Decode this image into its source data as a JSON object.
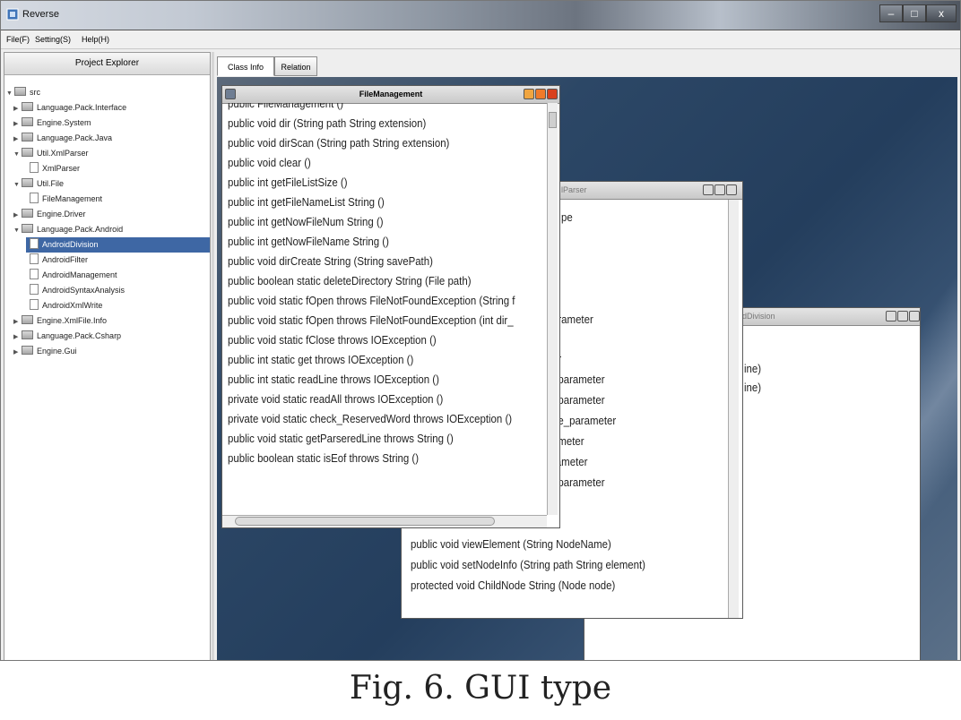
{
  "window": {
    "title": "Reverse",
    "min": "–",
    "max": "□",
    "close": "x"
  },
  "menu": [
    "File(F)",
    "Setting(S)",
    "Help(H)"
  ],
  "explorer": {
    "header": "Project Explorer",
    "root": "src",
    "nodes": [
      {
        "label": "Language.Pack.Interface",
        "type": "folder"
      },
      {
        "label": "Engine.System",
        "type": "folder"
      },
      {
        "label": "Language.Pack.Java",
        "type": "folder"
      },
      {
        "label": "Util.XmlParser",
        "type": "folder"
      },
      {
        "label": "XmlParser",
        "type": "file"
      },
      {
        "label": "Util.File",
        "type": "folder"
      },
      {
        "label": "FileManagement",
        "type": "file"
      },
      {
        "label": "Engine.Driver",
        "type": "folder"
      },
      {
        "label": "Language.Pack.Android",
        "type": "folder"
      },
      {
        "label": "AndroidDivision",
        "type": "file",
        "selected": true
      },
      {
        "label": "AndroidFilter",
        "type": "file"
      },
      {
        "label": "AndroidManagement",
        "type": "file"
      },
      {
        "label": "AndroidSyntaxAnalysis",
        "type": "file"
      },
      {
        "label": "AndroidXmlWrite",
        "type": "file"
      },
      {
        "label": "Engine.XmlFile.Info",
        "type": "folder"
      },
      {
        "label": "Language.Pack.Csharp",
        "type": "folder"
      },
      {
        "label": "Engine.Gui",
        "type": "folder"
      }
    ]
  },
  "tabs": [
    "Class Info",
    "Relation"
  ],
  "fm_window": {
    "title": "FileManagement",
    "methods": [
      "public FileManagement ()",
      "public void dir  (String path String extension)",
      "public void dirScan  (String path String extension)",
      "public void clear  ()",
      "public int getFileListSize  ()",
      "public int getFileNameList String  ()",
      "public int getNowFileNum String  ()",
      "public int getNowFileName String  ()",
      "public void dirCreate String  (String savePath)",
      "public boolean static deleteDirectory String  (File path)",
      "public void static fOpen throws FileNotFoundException  (String f",
      "public void static fOpen throws FileNotFoundException  (int dir_",
      "public void static fClose throws IOException  ()",
      "public int static get throws IOException  ()",
      "public int static readLine throws IOException  ()",
      "private void static readAll throws IOException  ()",
      "private void static check_ReservedWord throws IOException  ()",
      "public void static getParseredLine throws String  ()",
      "public boolean static isEof throws String  ()"
    ]
  },
  "xml_window": {
    "title": "lParser",
    "fragments": [
      "pe",
      "arameter",
      "er",
      "_parameter",
      "_parameter",
      "pe_parameter",
      "ameter",
      "rameter",
      "_parameter"
    ],
    "methods": [
      "public void viewElement  (String NodeName)",
      "public void setNodeInfo  (String path String element)",
      "protected void ChildNode String  (Node node)"
    ]
  },
  "ad_window": {
    "title": "dDivision",
    "fragments": [
      "ine)",
      "ine)"
    ]
  },
  "caption": "Fig. 6. GUI type"
}
